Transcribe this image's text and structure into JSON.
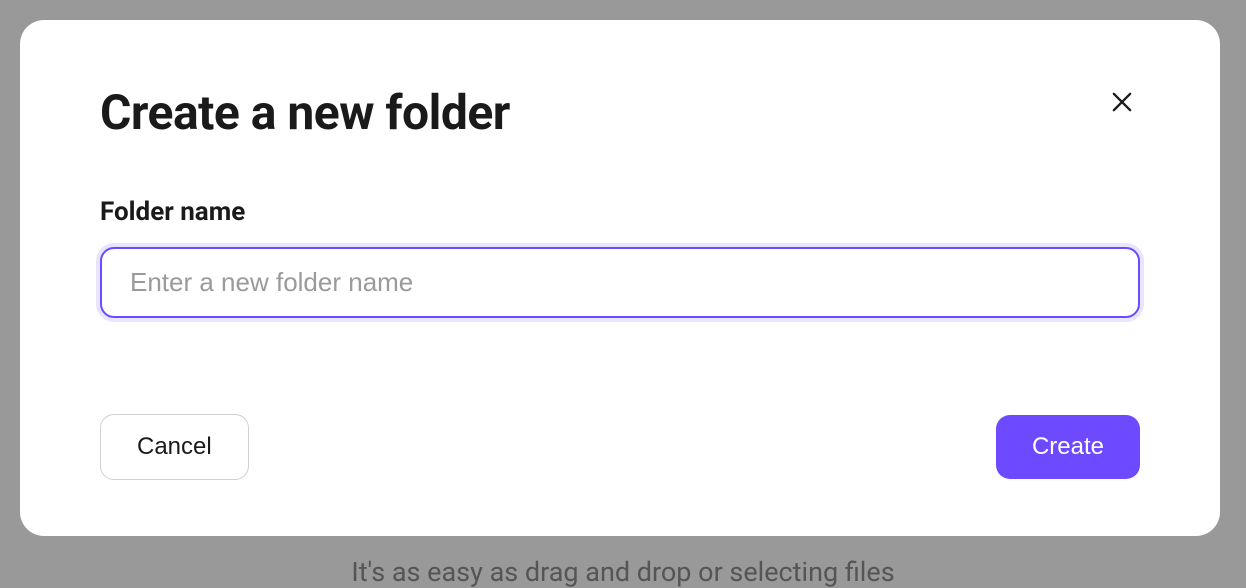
{
  "modal": {
    "title": "Create a new folder",
    "form": {
      "label": "Folder name",
      "placeholder": "Enter a new folder name",
      "value": ""
    },
    "buttons": {
      "cancel": "Cancel",
      "create": "Create"
    }
  },
  "background": {
    "hint_text": "It's as easy as drag and drop or selecting files"
  },
  "colors": {
    "accent": "#6d4aff",
    "overlay": "#999999"
  }
}
